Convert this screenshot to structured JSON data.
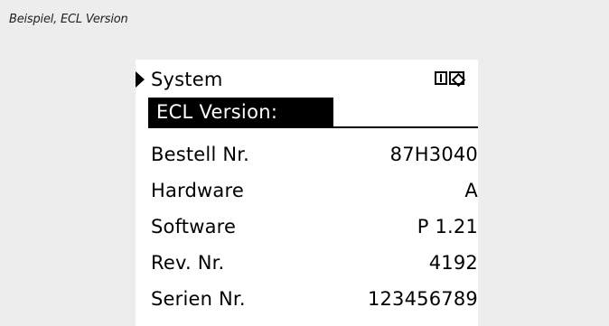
{
  "caption": "Beispiel, ECL Version",
  "display": {
    "menu_title": "System",
    "menu_icon": "screen-split-icon",
    "subtitle": "ECL Version:",
    "rows": [
      {
        "label": "Bestell Nr.",
        "value": "87H3040"
      },
      {
        "label": "Hardware",
        "value": "A"
      },
      {
        "label": "Software",
        "value": "P 1.21"
      },
      {
        "label": "Rev. Nr.",
        "value": "4192"
      },
      {
        "label": "Serien Nr.",
        "value": "123456789"
      }
    ]
  },
  "colors": {
    "page_background": "#ededed",
    "display_background": "#ffffff",
    "display_text": "#000000",
    "highlight_background": "#000000",
    "highlight_text": "#ffffff"
  }
}
